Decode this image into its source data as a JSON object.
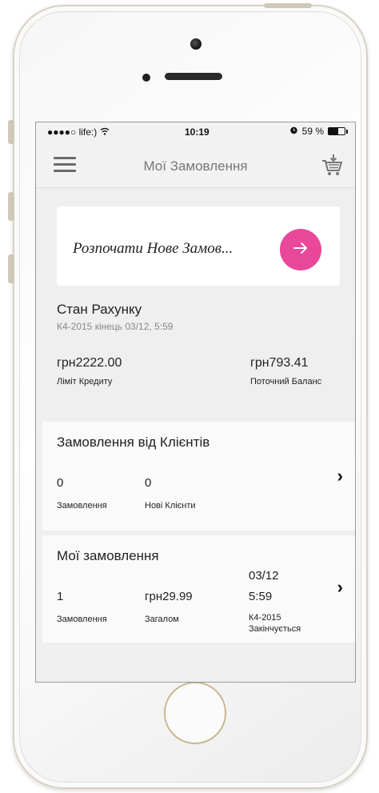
{
  "status_bar": {
    "carrier": "●●●●○ life:)",
    "time": "10:19",
    "battery_text": "59 %",
    "battery_level": 0.59
  },
  "nav": {
    "title": "Мої Замовлення",
    "menu_icon": "hamburger-icon",
    "cart_icon": "cart-icon"
  },
  "new_order": {
    "label": "Розпочати Нове Замов...",
    "button_icon": "arrow-right-icon",
    "accent_color": "#e9479a"
  },
  "account": {
    "title": "Стан Рахунку",
    "subtitle": "К4-2015 кінець 03/12, 5:59",
    "credit_limit_value": "грн2222.00",
    "credit_limit_label": "Ліміт Кредиту",
    "balance_value": "грн793.41",
    "balance_label": "Поточний Баланс"
  },
  "client_orders": {
    "title": "Замовлення від Клієнтів",
    "orders_value": "0",
    "orders_label": "Замовлення",
    "new_clients_value": "0",
    "new_clients_label": "Нові Клієнти"
  },
  "my_orders": {
    "title": "Мої замовлення",
    "orders_value": "1",
    "orders_label": "Замовлення",
    "total_value": "грн29.99",
    "total_label": "Загалом",
    "end_date": "03/12",
    "end_time": "5:59",
    "period_label": "К4-2015",
    "ends_label": "Закінчується"
  }
}
